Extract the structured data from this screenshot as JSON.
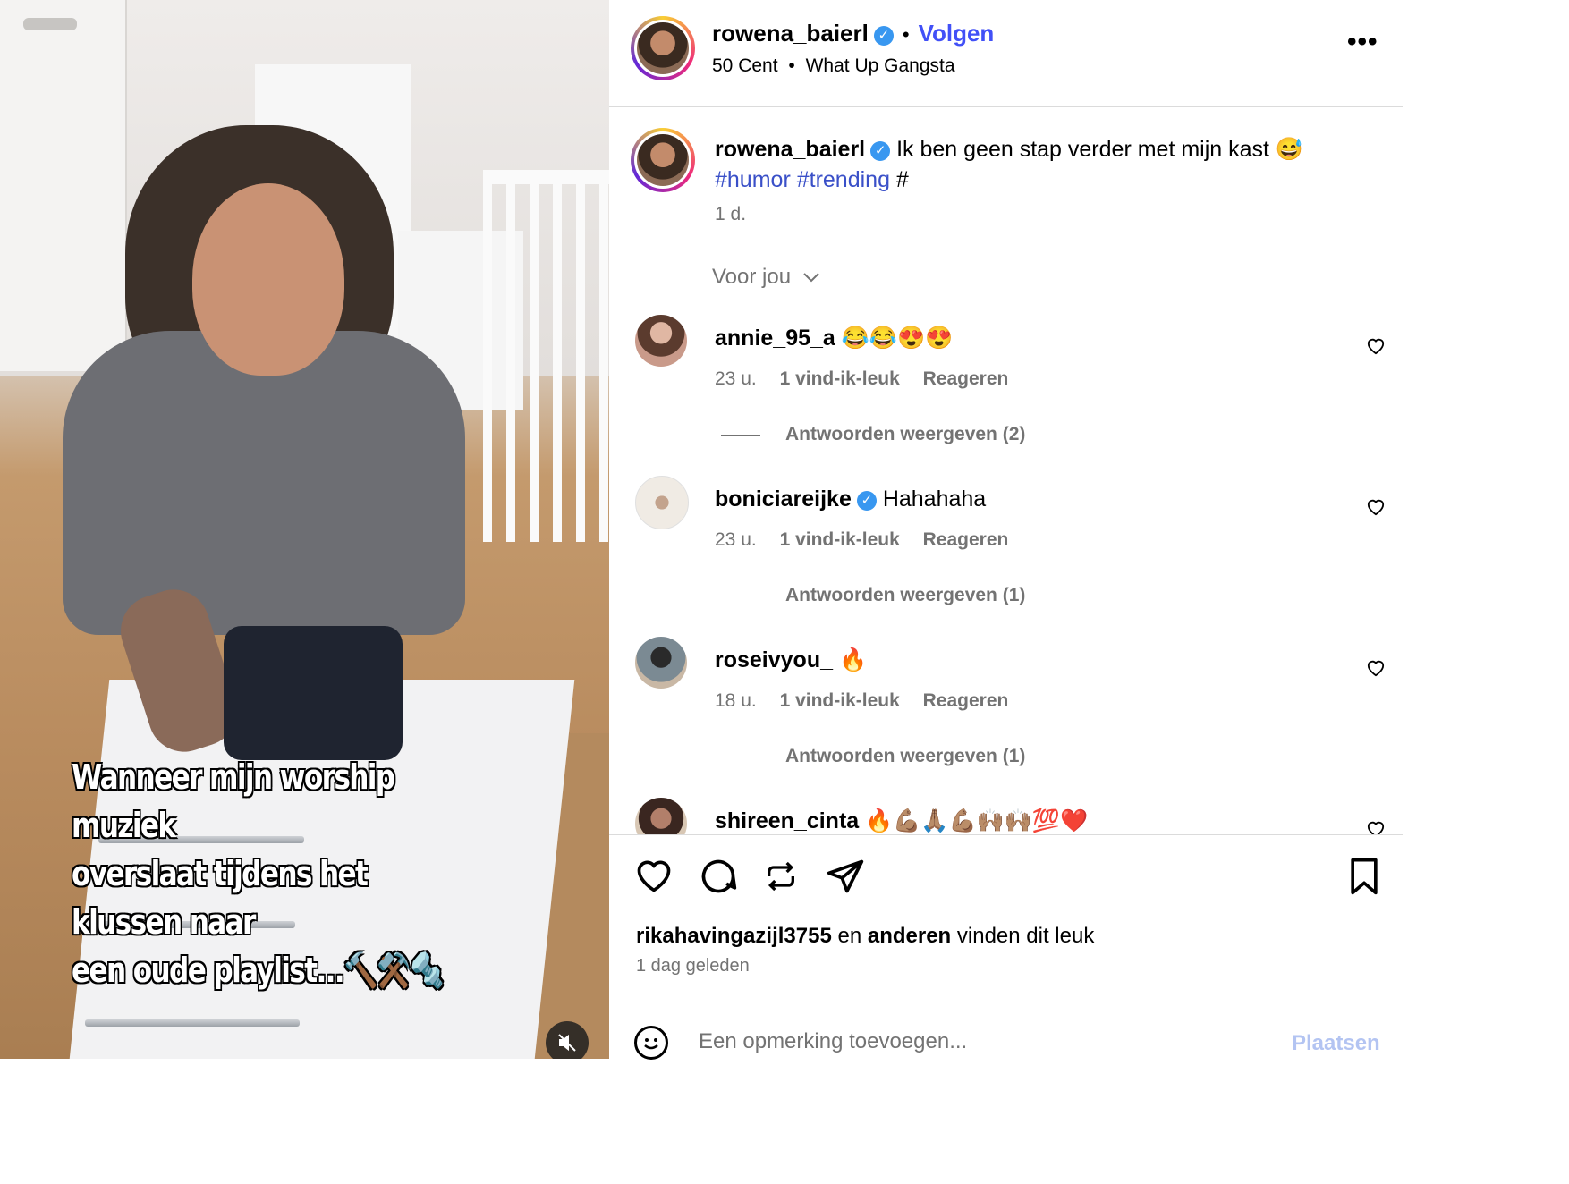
{
  "video": {
    "caption_lines": [
      "Wanneer mijn worship muziek",
      "overslaat tijdens het klussen naar",
      "een oude playlist...🔨⚒️🔩"
    ],
    "mute_icon": "speaker-muted-icon"
  },
  "header": {
    "username": "rowena_baierl",
    "separator": "•",
    "follow_label": "Volgen",
    "audio_artist": "50 Cent",
    "audio_separator": "•",
    "audio_title": "What Up Gangsta",
    "more_label": "•••"
  },
  "post": {
    "username": "rowena_baierl",
    "caption": "Ik ben geen stap verder met mijn kast 😅",
    "hashtags": [
      "#humor",
      "#trending",
      "#"
    ],
    "time": "1 d."
  },
  "filter_label": "Voor jou",
  "comments": [
    {
      "username": "annie_95_a",
      "text": "😂😂😍😍",
      "verified": false,
      "time": "23 u.",
      "likes": "1 vind-ik-leuk",
      "reply_label": "Reageren",
      "replies": "Antwoorden weergeven (2)",
      "avatar_color": "#b88b78"
    },
    {
      "username": "boniciareijke",
      "text": "Hahahaha",
      "verified": true,
      "time": "23 u.",
      "likes": "1 vind-ik-leuk",
      "reply_label": "Reageren",
      "replies": "Antwoorden weergeven (1)",
      "avatar_color": "#eae3da"
    },
    {
      "username": "roseivyou_",
      "text": "🔥",
      "verified": false,
      "time": "18 u.",
      "likes": "1 vind-ik-leuk",
      "reply_label": "Reageren",
      "replies": "Antwoorden weergeven (1)",
      "avatar_color": "#5d6c78"
    },
    {
      "username": "shireen_cinta",
      "text": "🔥💪🏽🙏🏽💪🏽🙌🏽🙌🏽💯❤️",
      "verified": false,
      "avatar_color": "#8a6a5a"
    }
  ],
  "footer": {
    "liked_by_user": "rikahavingazijl3755",
    "liked_connector": "en",
    "liked_others": "anderen",
    "liked_suffix": "vinden dit leuk",
    "date": "1 dag geleden",
    "comment_placeholder": "Een opmerking toevoegen...",
    "post_label": "Plaatsen"
  },
  "colors": {
    "link_blue": "#4150f7",
    "hashtag_blue": "#3a50c8",
    "verified_blue": "#3897f0",
    "muted_text": "#737373",
    "post_disabled": "#b3c4f2"
  }
}
